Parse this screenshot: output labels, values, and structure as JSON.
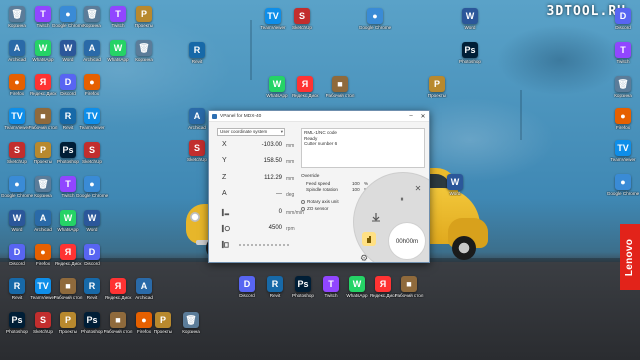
{
  "watermark": "3DTOOL.RU",
  "lenovo_badge": "Lenovo",
  "desktop_icons": [
    {
      "label": "Корзина",
      "glyph": "🗑",
      "color": "#5b7c99"
    },
    {
      "label": "Archicad",
      "glyph": "A",
      "color": "#2a6aa8"
    },
    {
      "label": "Firefox",
      "glyph": "●",
      "color": "#e66000"
    },
    {
      "label": "TeamViewer",
      "glyph": "TV",
      "color": "#0e8ee9"
    },
    {
      "label": "SketchUp",
      "glyph": "S",
      "color": "#c22e2e"
    },
    {
      "label": "Google Chrome",
      "glyph": "●",
      "color": "#3a8bd6"
    },
    {
      "label": "Word",
      "glyph": "W",
      "color": "#2b579a"
    },
    {
      "label": "Discord",
      "glyph": "D",
      "color": "#5865f2"
    },
    {
      "label": "Revit",
      "glyph": "R",
      "color": "#1769a8"
    },
    {
      "label": "Photoshop",
      "glyph": "Ps",
      "color": "#001e36"
    },
    {
      "label": "Twitch",
      "glyph": "T",
      "color": "#9146ff"
    },
    {
      "label": "WhatsApp",
      "glyph": "W",
      "color": "#25d366"
    },
    {
      "label": "Яндекс.Диск",
      "glyph": "Я",
      "color": "#f33"
    },
    {
      "label": "Рабочий стол",
      "glyph": "■",
      "color": "#8f6a3c"
    },
    {
      "label": "Проекты",
      "glyph": "P",
      "color": "#b8892e"
    }
  ],
  "vpanel": {
    "title": "VPanel for MDX-40",
    "coordinate_system": "User coordinate system",
    "axes": [
      {
        "axis": "X",
        "value": "-103.00",
        "unit": "mm"
      },
      {
        "axis": "Y",
        "value": "158.50",
        "unit": "mm"
      },
      {
        "axis": "Z",
        "value": "112.29",
        "unit": "mm"
      },
      {
        "axis": "A",
        "value": "---",
        "unit": "deg"
      }
    ],
    "spindle_feed": {
      "value": "0",
      "unit": "mm/min"
    },
    "spindle_rpm": {
      "value": "4500",
      "unit": "rpm"
    },
    "status_lines": [
      "RML-1/NC code",
      "Ready",
      "Cutter number 6"
    ],
    "override": {
      "title": "Override",
      "feed_label": "Feed speed",
      "feed_value": "100",
      "feed_unit": "%",
      "spindle_label": "Spindle rotation",
      "spindle_value": "100",
      "spindle_unit": "%"
    },
    "options": [
      "Rotary axis unit",
      "ZO sensor"
    ],
    "timer": "00h00m"
  }
}
